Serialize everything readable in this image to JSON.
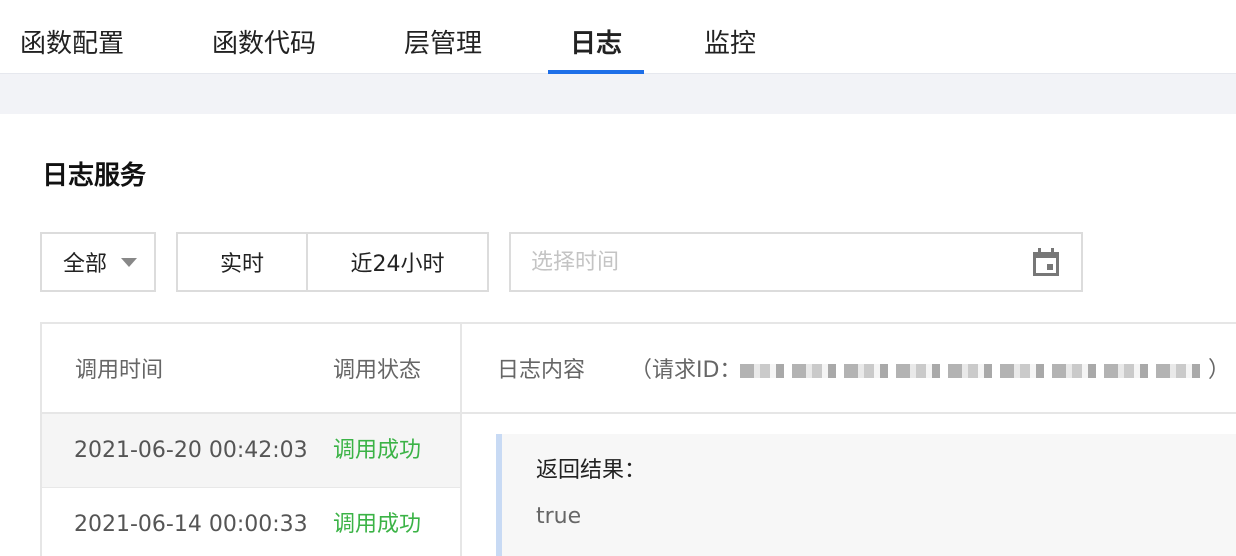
{
  "tabs": [
    {
      "label": "函数配置",
      "active": false
    },
    {
      "label": "函数代码",
      "active": false
    },
    {
      "label": "层管理",
      "active": false
    },
    {
      "label": "日志",
      "active": true
    },
    {
      "label": "监控",
      "active": false
    }
  ],
  "section_title": "日志服务",
  "filters": {
    "scope": "全部",
    "realtime": "实时",
    "last24h": "近24小时",
    "date_placeholder": "选择时间"
  },
  "table": {
    "col_time": "调用时间",
    "col_status": "调用状态",
    "col_content": "日志内容",
    "request_id_label": "（请求ID：",
    "request_id_close": "）",
    "rows": [
      {
        "time": "2021-06-20 00:42:03",
        "status": "调用成功"
      },
      {
        "time": "2021-06-14 00:00:33",
        "status": "调用成功"
      }
    ]
  },
  "log": {
    "result_label": "返回结果：",
    "result_value": "true"
  },
  "colors": {
    "accent": "#1e6fe8",
    "success": "#3bb346"
  },
  "icons": {
    "date_picker": "calendar-icon",
    "dropdown": "chevron-down-icon"
  }
}
